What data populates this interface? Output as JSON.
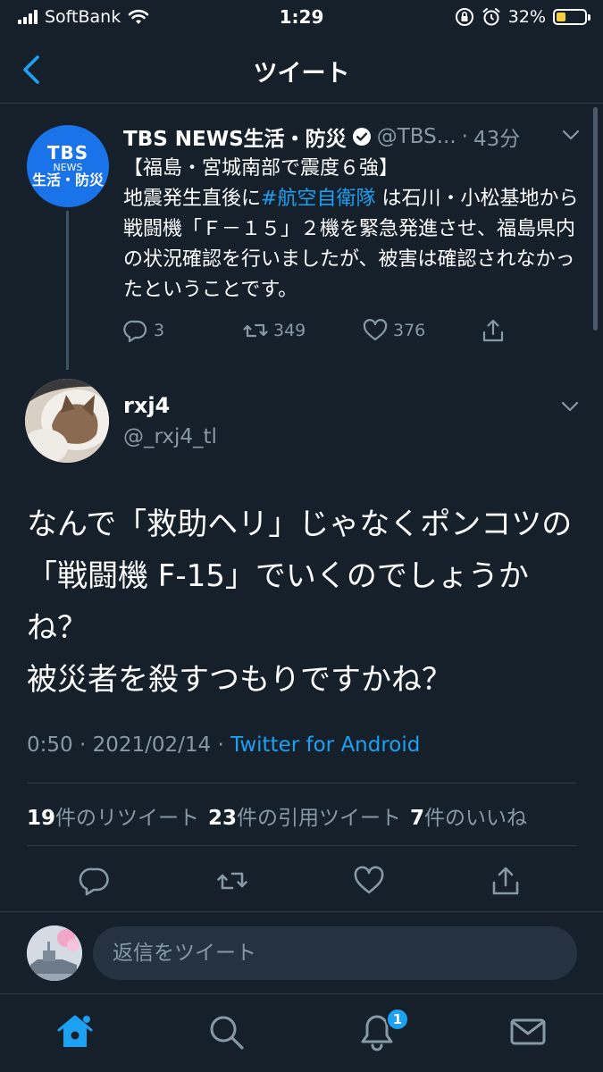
{
  "status_bar": {
    "carrier": "SoftBank",
    "time": "1:29",
    "battery": "32%",
    "battery_level": 0.32
  },
  "header": {
    "title": "ツイート"
  },
  "quoted_tweet": {
    "avatar_text": [
      "TBS",
      "NEWS",
      "生活・防災"
    ],
    "name": "TBS NEWS生活・防災",
    "handle": "@TBS...",
    "separator": "·",
    "time": "43分",
    "text_line1": "【福島・宮城南部で震度６強】",
    "text_pre_hashtag": "地震発生直後に",
    "hashtag": "#航空自衛隊",
    "text_post_hashtag": " は石川・小松基地から戦闘機「Ｆ－１５」２機を緊急発進させ、福島県内の状況確認を行いましたが、被害は確認されなかったということです。",
    "reply_count": "3",
    "retweet_count": "349",
    "like_count": "376"
  },
  "main_tweet": {
    "name": "rxj4",
    "handle": "@_rxj4_tl",
    "text": "なんで「救助ヘリ」じゃなくポンコツの「戦闘機 F-15」でいくのでしょうかね？\n被災者を殺すつもりですかね？",
    "time": "0:50",
    "date": "2021/02/14",
    "separator": "·",
    "app": "Twitter for Android",
    "retweets_num": "19",
    "retweets_label": "件のリツイート",
    "quotes_num": "23",
    "quotes_label": "件の引用ツイート",
    "likes_num": "7",
    "likes_label": "件のいいね"
  },
  "reply": {
    "placeholder": "返信をツイート"
  },
  "tabbar": {
    "notification_badge": "1"
  },
  "colors": {
    "background": "#15202b",
    "accent": "#1da1f2",
    "muted": "#8899a6",
    "divider": "#2f3b47"
  }
}
